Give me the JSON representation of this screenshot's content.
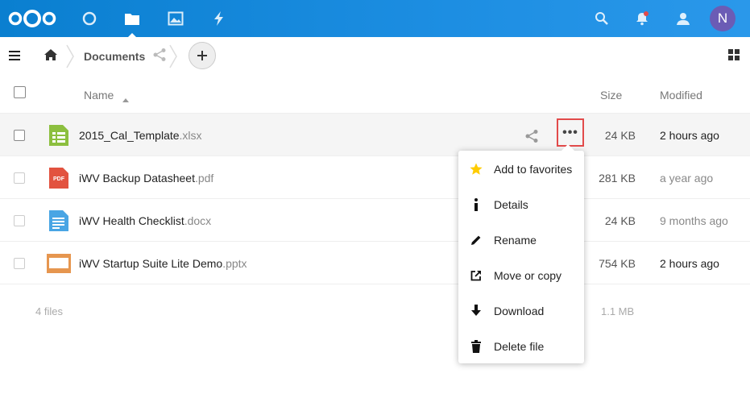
{
  "header": {
    "user_initial": "N",
    "colors": {
      "bar": "#0082c9",
      "avatar": "#6b5cb5",
      "highlight_border": "#e24b4b"
    }
  },
  "breadcrumb": {
    "current": "Documents"
  },
  "table": {
    "columns": {
      "name": "Name",
      "size": "Size",
      "modified": "Modified"
    },
    "rows": [
      {
        "base": "2015_Cal_Template",
        "ext": ".xlsx",
        "size": "24 KB",
        "modified": "2 hours ago",
        "icon": "spreadsheet-icon"
      },
      {
        "base": "iWV Backup Datasheet",
        "ext": ".pdf",
        "size": "281 KB",
        "modified": "a year ago",
        "icon": "pdf-icon",
        "icon_text": "PDF"
      },
      {
        "base": "iWV Health Checklist",
        "ext": ".docx",
        "size": "24 KB",
        "modified": "9 months ago",
        "icon": "document-icon"
      },
      {
        "base": "iWV Startup Suite Lite Demo",
        "ext": ".pptx",
        "size": "754 KB",
        "modified": "2 hours ago",
        "icon": "presentation-icon"
      }
    ],
    "summary": {
      "files": "4 files",
      "total_size": "1.1 MB"
    }
  },
  "more_button": {
    "label": "•••"
  },
  "context_menu": {
    "items": [
      {
        "label": "Add to favorites",
        "icon": "star-icon"
      },
      {
        "label": "Details",
        "icon": "info-icon"
      },
      {
        "label": "Rename",
        "icon": "pencil-icon"
      },
      {
        "label": "Move or copy",
        "icon": "external-link-icon"
      },
      {
        "label": "Download",
        "icon": "download-icon"
      },
      {
        "label": "Delete file",
        "icon": "trash-icon"
      }
    ]
  }
}
